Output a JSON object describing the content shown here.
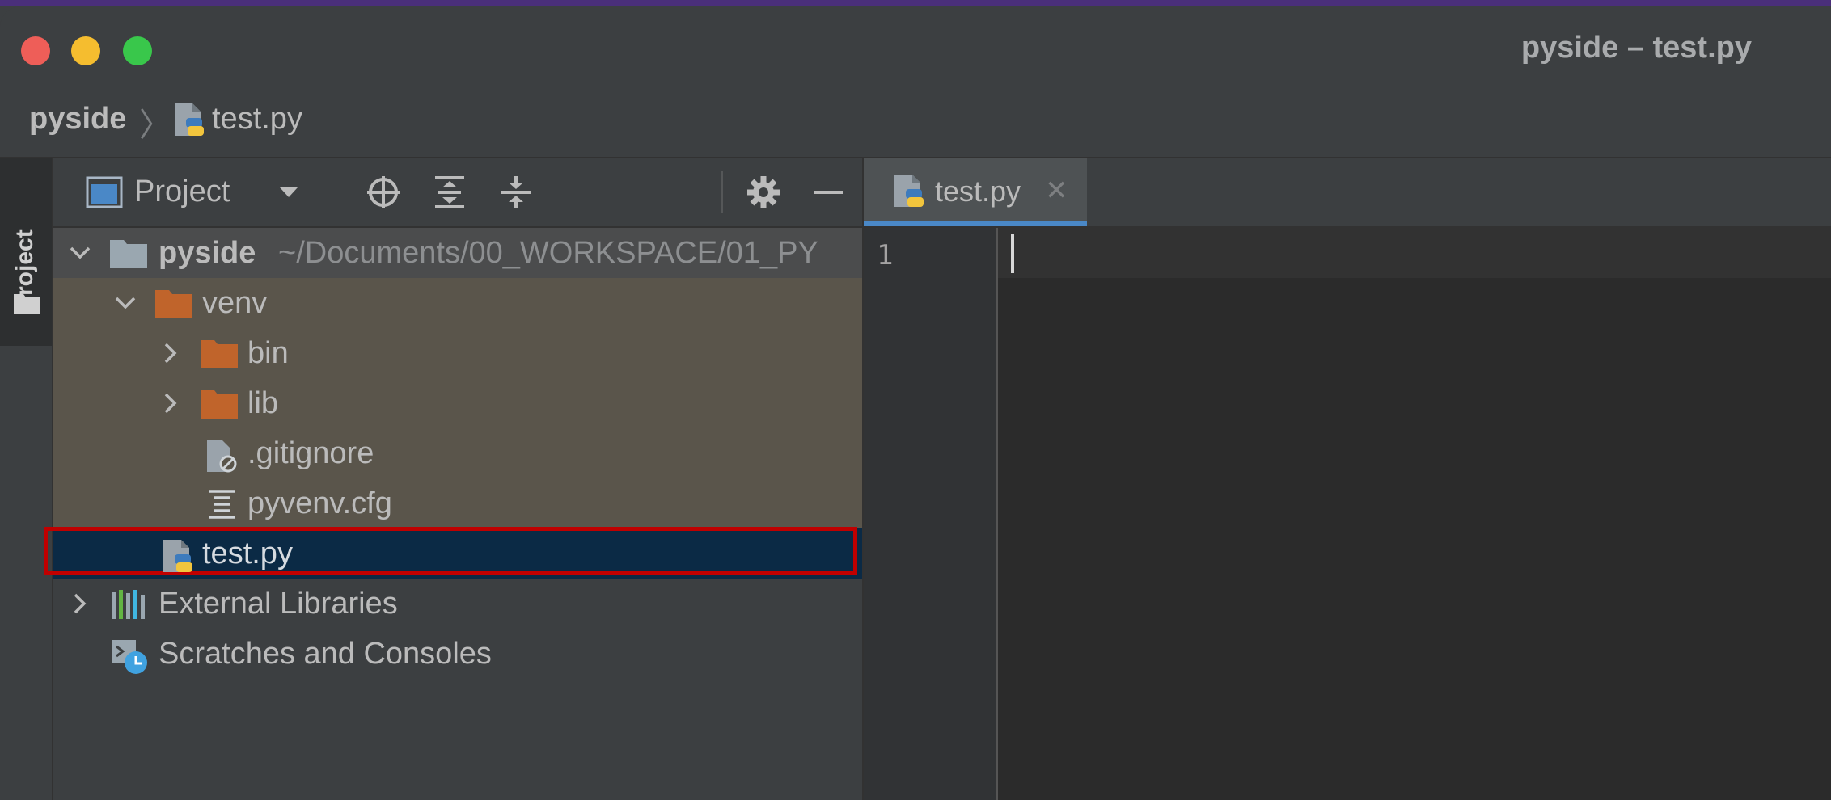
{
  "window": {
    "title": "pyside – test.py"
  },
  "breadcrumb": {
    "project": "pyside",
    "file": "test.py"
  },
  "tool_stripe": {
    "label": "Project"
  },
  "panel": {
    "title": "Project"
  },
  "tree": {
    "root": {
      "name": "pyside",
      "path": "~/Documents/00_WORKSPACE/01_PY"
    },
    "venv": "venv",
    "bin": "bin",
    "lib": "lib",
    "gitignore": ".gitignore",
    "pyvenv": "pyvenv.cfg",
    "test_file": "test.py",
    "external": "External Libraries",
    "scratches": "Scratches and Consoles"
  },
  "editor": {
    "tab_label": "test.py",
    "close_glyph": "✕",
    "line_number": "1"
  },
  "colors": {
    "selection": "#0b2a45",
    "highlight_frame": "#c00000",
    "folder": "#c0642b",
    "tab_accent": "#4a88c7"
  }
}
